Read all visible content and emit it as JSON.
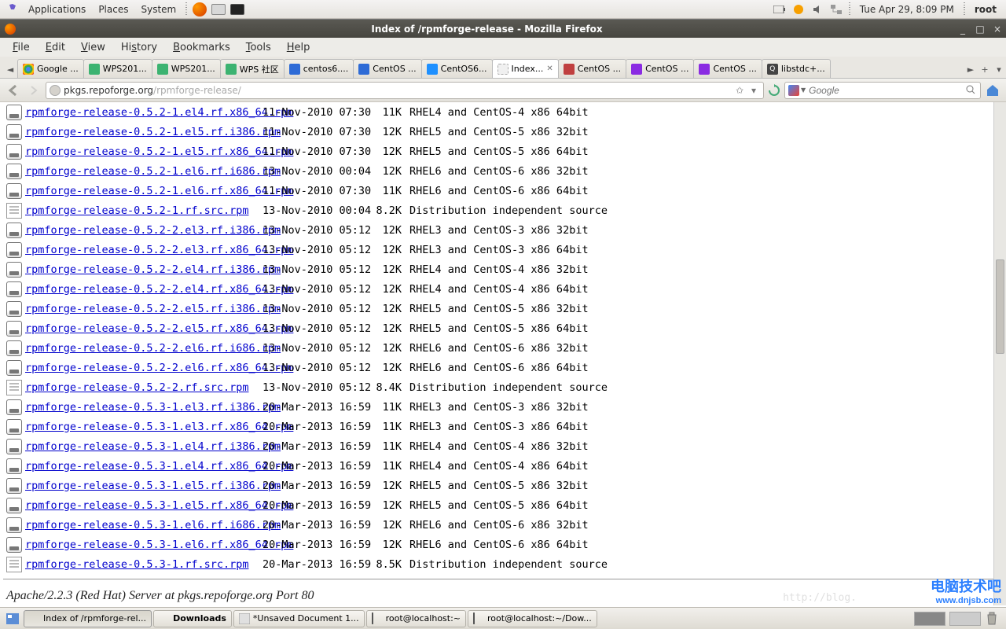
{
  "panel": {
    "applications": "Applications",
    "places": "Places",
    "system": "System",
    "clock": "Tue Apr 29,  8:09 PM",
    "user": "root"
  },
  "window": {
    "title": "Index of /rpmforge-release - Mozilla Firefox"
  },
  "menubar": {
    "file": "File",
    "edit": "Edit",
    "view": "View",
    "history": "History",
    "bookmarks": "Bookmarks",
    "tools": "Tools",
    "help": "Help"
  },
  "tabs": [
    {
      "label": "Google ...",
      "fav": "fav-google"
    },
    {
      "label": "WPS201...",
      "fav": "fav-wps"
    },
    {
      "label": "WPS201...",
      "fav": "fav-wps"
    },
    {
      "label": "WPS 社区",
      "fav": "fav-wps"
    },
    {
      "label": "centos6....",
      "fav": "fav-baidu"
    },
    {
      "label": "CentOS ...",
      "fav": "fav-baidu"
    },
    {
      "label": "CentOS6...",
      "fav": "fav-ie"
    },
    {
      "label": "Index...",
      "fav": "fav-blank",
      "active": true,
      "close": true
    },
    {
      "label": "CentOS ...",
      "fav": "fav-red"
    },
    {
      "label": "CentOS ...",
      "fav": "fav-centos"
    },
    {
      "label": "CentOS ...",
      "fav": "fav-centos"
    },
    {
      "label": "libstdc+...",
      "fav": "fav-q"
    }
  ],
  "url": {
    "host": "pkgs.repoforge.org",
    "path": "/rpmforge-release/"
  },
  "search": {
    "placeholder": "Google"
  },
  "files": [
    {
      "name": "rpmforge-release-0.5.2-1.el4.rf.x86_64.rpm",
      "date": "11-Nov-2010 07:30",
      "size": "11K",
      "desc": "RHEL4 and CentOS-4 x86 64bit",
      "t": "rpm"
    },
    {
      "name": "rpmforge-release-0.5.2-1.el5.rf.i386.rpm",
      "date": "11-Nov-2010 07:30",
      "size": "12K",
      "desc": "RHEL5 and CentOS-5 x86 32bit",
      "t": "rpm"
    },
    {
      "name": "rpmforge-release-0.5.2-1.el5.rf.x86_64.rpm",
      "date": "11-Nov-2010 07:30",
      "size": "12K",
      "desc": "RHEL5 and CentOS-5 x86 64bit",
      "t": "rpm"
    },
    {
      "name": "rpmforge-release-0.5.2-1.el6.rf.i686.rpm",
      "date": "13-Nov-2010 00:04",
      "size": "12K",
      "desc": "RHEL6 and CentOS-6 x86 32bit",
      "t": "rpm"
    },
    {
      "name": "rpmforge-release-0.5.2-1.el6.rf.x86_64.rpm",
      "date": "11-Nov-2010 07:30",
      "size": "11K",
      "desc": "RHEL6 and CentOS-6 x86 64bit",
      "t": "rpm"
    },
    {
      "name": "rpmforge-release-0.5.2-1.rf.src.rpm",
      "date": "13-Nov-2010 00:04",
      "size": "8.2K",
      "desc": "Distribution independent source",
      "t": "src"
    },
    {
      "name": "rpmforge-release-0.5.2-2.el3.rf.i386.rpm",
      "date": "13-Nov-2010 05:12",
      "size": "12K",
      "desc": "RHEL3 and CentOS-3 x86 32bit",
      "t": "rpm"
    },
    {
      "name": "rpmforge-release-0.5.2-2.el3.rf.x86_64.rpm",
      "date": "13-Nov-2010 05:12",
      "size": "12K",
      "desc": "RHEL3 and CentOS-3 x86 64bit",
      "t": "rpm"
    },
    {
      "name": "rpmforge-release-0.5.2-2.el4.rf.i386.rpm",
      "date": "13-Nov-2010 05:12",
      "size": "12K",
      "desc": "RHEL4 and CentOS-4 x86 32bit",
      "t": "rpm"
    },
    {
      "name": "rpmforge-release-0.5.2-2.el4.rf.x86_64.rpm",
      "date": "13-Nov-2010 05:12",
      "size": "12K",
      "desc": "RHEL4 and CentOS-4 x86 64bit",
      "t": "rpm"
    },
    {
      "name": "rpmforge-release-0.5.2-2.el5.rf.i386.rpm",
      "date": "13-Nov-2010 05:12",
      "size": "12K",
      "desc": "RHEL5 and CentOS-5 x86 32bit",
      "t": "rpm"
    },
    {
      "name": "rpmforge-release-0.5.2-2.el5.rf.x86_64.rpm",
      "date": "13-Nov-2010 05:12",
      "size": "12K",
      "desc": "RHEL5 and CentOS-5 x86 64bit",
      "t": "rpm"
    },
    {
      "name": "rpmforge-release-0.5.2-2.el6.rf.i686.rpm",
      "date": "13-Nov-2010 05:12",
      "size": "12K",
      "desc": "RHEL6 and CentOS-6 x86 32bit",
      "t": "rpm"
    },
    {
      "name": "rpmforge-release-0.5.2-2.el6.rf.x86_64.rpm",
      "date": "13-Nov-2010 05:12",
      "size": "12K",
      "desc": "RHEL6 and CentOS-6 x86 64bit",
      "t": "rpm"
    },
    {
      "name": "rpmforge-release-0.5.2-2.rf.src.rpm",
      "date": "13-Nov-2010 05:12",
      "size": "8.4K",
      "desc": "Distribution independent source",
      "t": "src"
    },
    {
      "name": "rpmforge-release-0.5.3-1.el3.rf.i386.rpm",
      "date": "20-Mar-2013 16:59",
      "size": "11K",
      "desc": "RHEL3 and CentOS-3 x86 32bit",
      "t": "rpm"
    },
    {
      "name": "rpmforge-release-0.5.3-1.el3.rf.x86_64.rpm",
      "date": "20-Mar-2013 16:59",
      "size": "11K",
      "desc": "RHEL3 and CentOS-3 x86 64bit",
      "t": "rpm"
    },
    {
      "name": "rpmforge-release-0.5.3-1.el4.rf.i386.rpm",
      "date": "20-Mar-2013 16:59",
      "size": "11K",
      "desc": "RHEL4 and CentOS-4 x86 32bit",
      "t": "rpm"
    },
    {
      "name": "rpmforge-release-0.5.3-1.el4.rf.x86_64.rpm",
      "date": "20-Mar-2013 16:59",
      "size": "11K",
      "desc": "RHEL4 and CentOS-4 x86 64bit",
      "t": "rpm"
    },
    {
      "name": "rpmforge-release-0.5.3-1.el5.rf.i386.rpm",
      "date": "20-Mar-2013 16:59",
      "size": "12K",
      "desc": "RHEL5 and CentOS-5 x86 32bit",
      "t": "rpm"
    },
    {
      "name": "rpmforge-release-0.5.3-1.el5.rf.x86_64.rpm",
      "date": "20-Mar-2013 16:59",
      "size": "12K",
      "desc": "RHEL5 and CentOS-5 x86 64bit",
      "t": "rpm"
    },
    {
      "name": "rpmforge-release-0.5.3-1.el6.rf.i686.rpm",
      "date": "20-Mar-2013 16:59",
      "size": "12K",
      "desc": "RHEL6 and CentOS-6 x86 32bit",
      "t": "rpm"
    },
    {
      "name": "rpmforge-release-0.5.3-1.el6.rf.x86_64.rpm",
      "date": "20-Mar-2013 16:59",
      "size": "12K",
      "desc": "RHEL6 and CentOS-6 x86 64bit",
      "t": "rpm"
    },
    {
      "name": "rpmforge-release-0.5.3-1.rf.src.rpm",
      "date": "20-Mar-2013 16:59",
      "size": "8.5K",
      "desc": "Distribution independent source",
      "t": "src"
    }
  ],
  "server_sig": "Apache/2.2.3 (Red Hat) Server at pkgs.repoforge.org Port 80",
  "taskbar": [
    {
      "label": "Index of /rpmforge-rel...",
      "icon": "fx",
      "active": true
    },
    {
      "label": "Downloads",
      "icon": "fx",
      "bold": true
    },
    {
      "label": "*Unsaved Document 1...",
      "icon": "doc"
    },
    {
      "label": "root@localhost:~",
      "icon": "term"
    },
    {
      "label": "root@localhost:~/Dow...",
      "icon": "term"
    }
  ],
  "watermark": {
    "main": "电脑技术吧",
    "sub": "www.dnjsb.com"
  },
  "bg_url": "http://blog."
}
